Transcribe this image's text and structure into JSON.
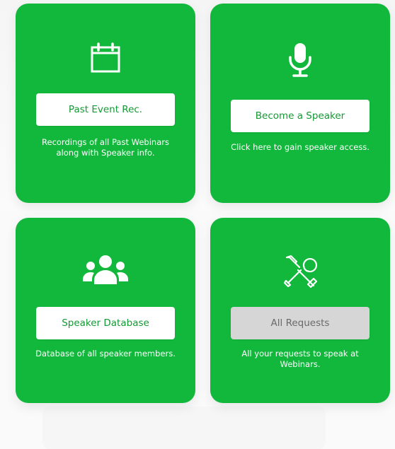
{
  "colors": {
    "card_green": "#12b83c",
    "button_text_green": "#139a34",
    "disabled_button_bg": "#d6d6d6",
    "disabled_button_text": "#6a6a6a"
  },
  "cards": [
    {
      "icon": "calendar-icon",
      "button_label": "Past Event Rec.",
      "description": "Recordings of all Past Webinars along with Speaker info."
    },
    {
      "icon": "microphone-icon",
      "button_label": "Become a Speaker",
      "description": "Click here to gain speaker access."
    },
    {
      "icon": "users-group-icon",
      "button_label": "Speaker Database",
      "description": "Database of all speaker members."
    },
    {
      "icon": "tools-icon",
      "button_label": "All Requests",
      "button_disabled": true,
      "description": "All your requests to speak at Webinars."
    }
  ]
}
